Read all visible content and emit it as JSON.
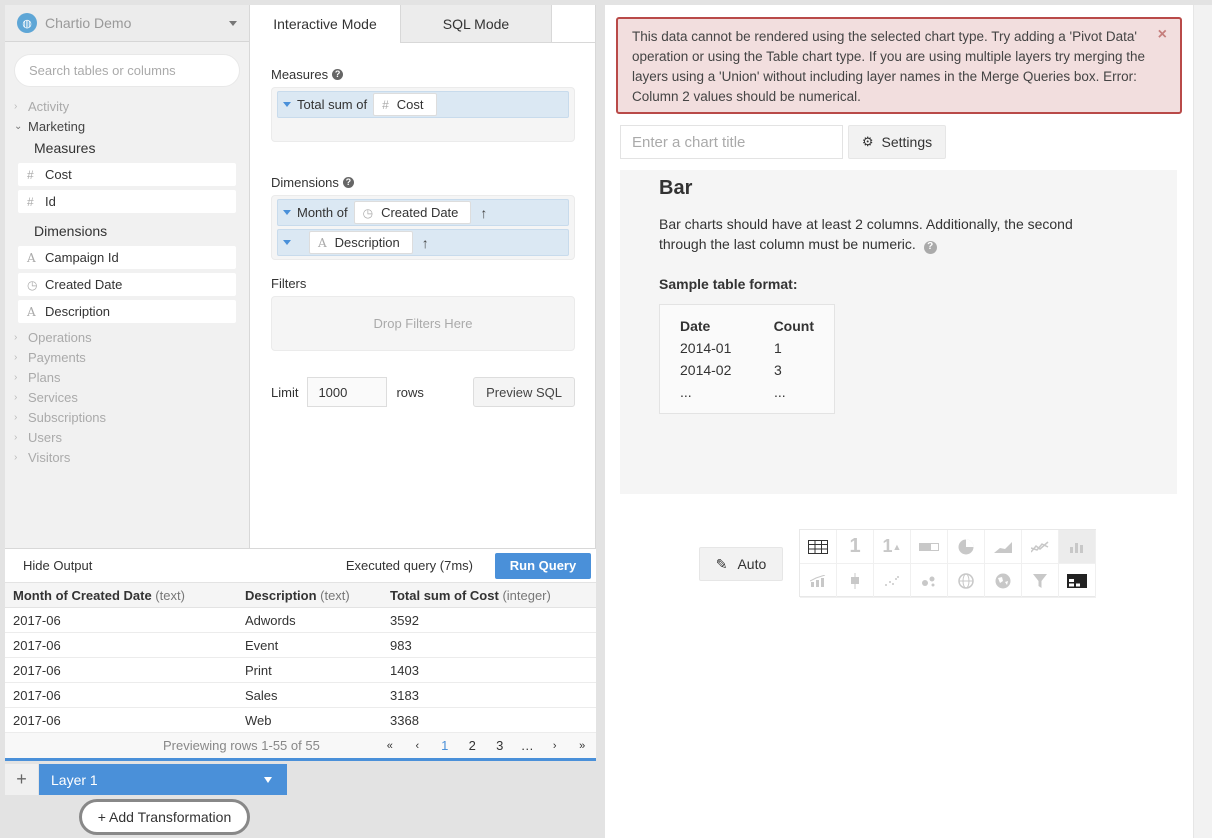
{
  "sidebar": {
    "datasource": "Chartio Demo",
    "search_placeholder": "Search tables or columns",
    "tables_before": [
      "Activity"
    ],
    "open_table": "Marketing",
    "measures_label": "Measures",
    "measures": [
      {
        "type": "#",
        "name": "Cost"
      },
      {
        "type": "#",
        "name": "Id"
      }
    ],
    "dimensions_label": "Dimensions",
    "dimensions": [
      {
        "type": "A",
        "name": "Campaign Id"
      },
      {
        "type": "clock",
        "name": "Created Date"
      },
      {
        "type": "A",
        "name": "Description"
      }
    ],
    "tables_after": [
      "Operations",
      "Payments",
      "Plans",
      "Services",
      "Subscriptions",
      "Users",
      "Visitors"
    ]
  },
  "builder": {
    "tabs": [
      "Interactive Mode",
      "SQL Mode"
    ],
    "measures_label": "Measures",
    "measure_pill": {
      "agg": "Total sum of",
      "type": "#",
      "field": "Cost"
    },
    "dimensions_label": "Dimensions",
    "dimension_pills": [
      {
        "agg": "Month of",
        "type": "clock",
        "field": "Created Date",
        "sort": "↑"
      },
      {
        "agg": "",
        "type": "A",
        "field": "Description",
        "sort": "↑"
      }
    ],
    "filters_label": "Filters",
    "filters_placeholder": "Drop Filters Here",
    "limit_label": "Limit",
    "limit_value": "1000",
    "rows_label": "rows",
    "preview_sql": "Preview SQL"
  },
  "output": {
    "hide_label": "Hide Output",
    "executed": "Executed query (7ms)",
    "run_label": "Run Query",
    "columns": [
      {
        "name": "Month of Created Date",
        "type": "(text)"
      },
      {
        "name": "Description",
        "type": "(text)"
      },
      {
        "name": "Total sum of Cost",
        "type": "(integer)"
      }
    ],
    "rows": [
      [
        "2017-06",
        "Adwords",
        "3592"
      ],
      [
        "2017-06",
        "Event",
        "983"
      ],
      [
        "2017-06",
        "Print",
        "1403"
      ],
      [
        "2017-06",
        "Sales",
        "3183"
      ],
      [
        "2017-06",
        "Web",
        "3368"
      ]
    ],
    "preview_info": "Previewing rows 1-55 of 55",
    "pages": [
      "«",
      "‹",
      "1",
      "2",
      "3",
      "…",
      "›",
      "»"
    ],
    "active_page": "1"
  },
  "layer": {
    "add_symbol": "+",
    "name": "Layer 1",
    "add_transformation": "+ Add Transformation"
  },
  "chart": {
    "error": "This data cannot be rendered using the selected chart type. Try adding a 'Pivot Data' operation or using the Table chart type. If you are using multiple layers try merging the layers using a 'Union' without including layer names in the Merge Queries box. Error: Column 2 values should be numerical.",
    "close_symbol": "×",
    "title_placeholder": "Enter a chart title",
    "settings_label": "Settings",
    "hint_title": "Bar",
    "hint_text": "Bar charts should have at least 2 columns. Additionally, the second through the last column must be numeric.",
    "sample_label": "Sample table format:",
    "sample_header": [
      "Date",
      "Count"
    ],
    "sample_rows": [
      [
        "2014-01",
        "1"
      ],
      [
        "2014-02",
        "3"
      ],
      [
        "...",
        "..."
      ]
    ],
    "auto_label": "Auto"
  },
  "chart_types": [
    "table-icon",
    "single-value-icon",
    "single-value-trend-icon",
    "progress-bar-icon",
    "pie-icon",
    "area-icon",
    "line-icon",
    "bar-icon",
    "bar-line-icon",
    "box-plot-icon",
    "scatter-icon",
    "bubble-icon",
    "geo-map-icon",
    "world-map-icon",
    "funnel-icon",
    "pivot-table-icon"
  ],
  "colors": {
    "accent": "#4a90d9",
    "error_bg": "#f2dede",
    "error_border": "#b94a48"
  }
}
